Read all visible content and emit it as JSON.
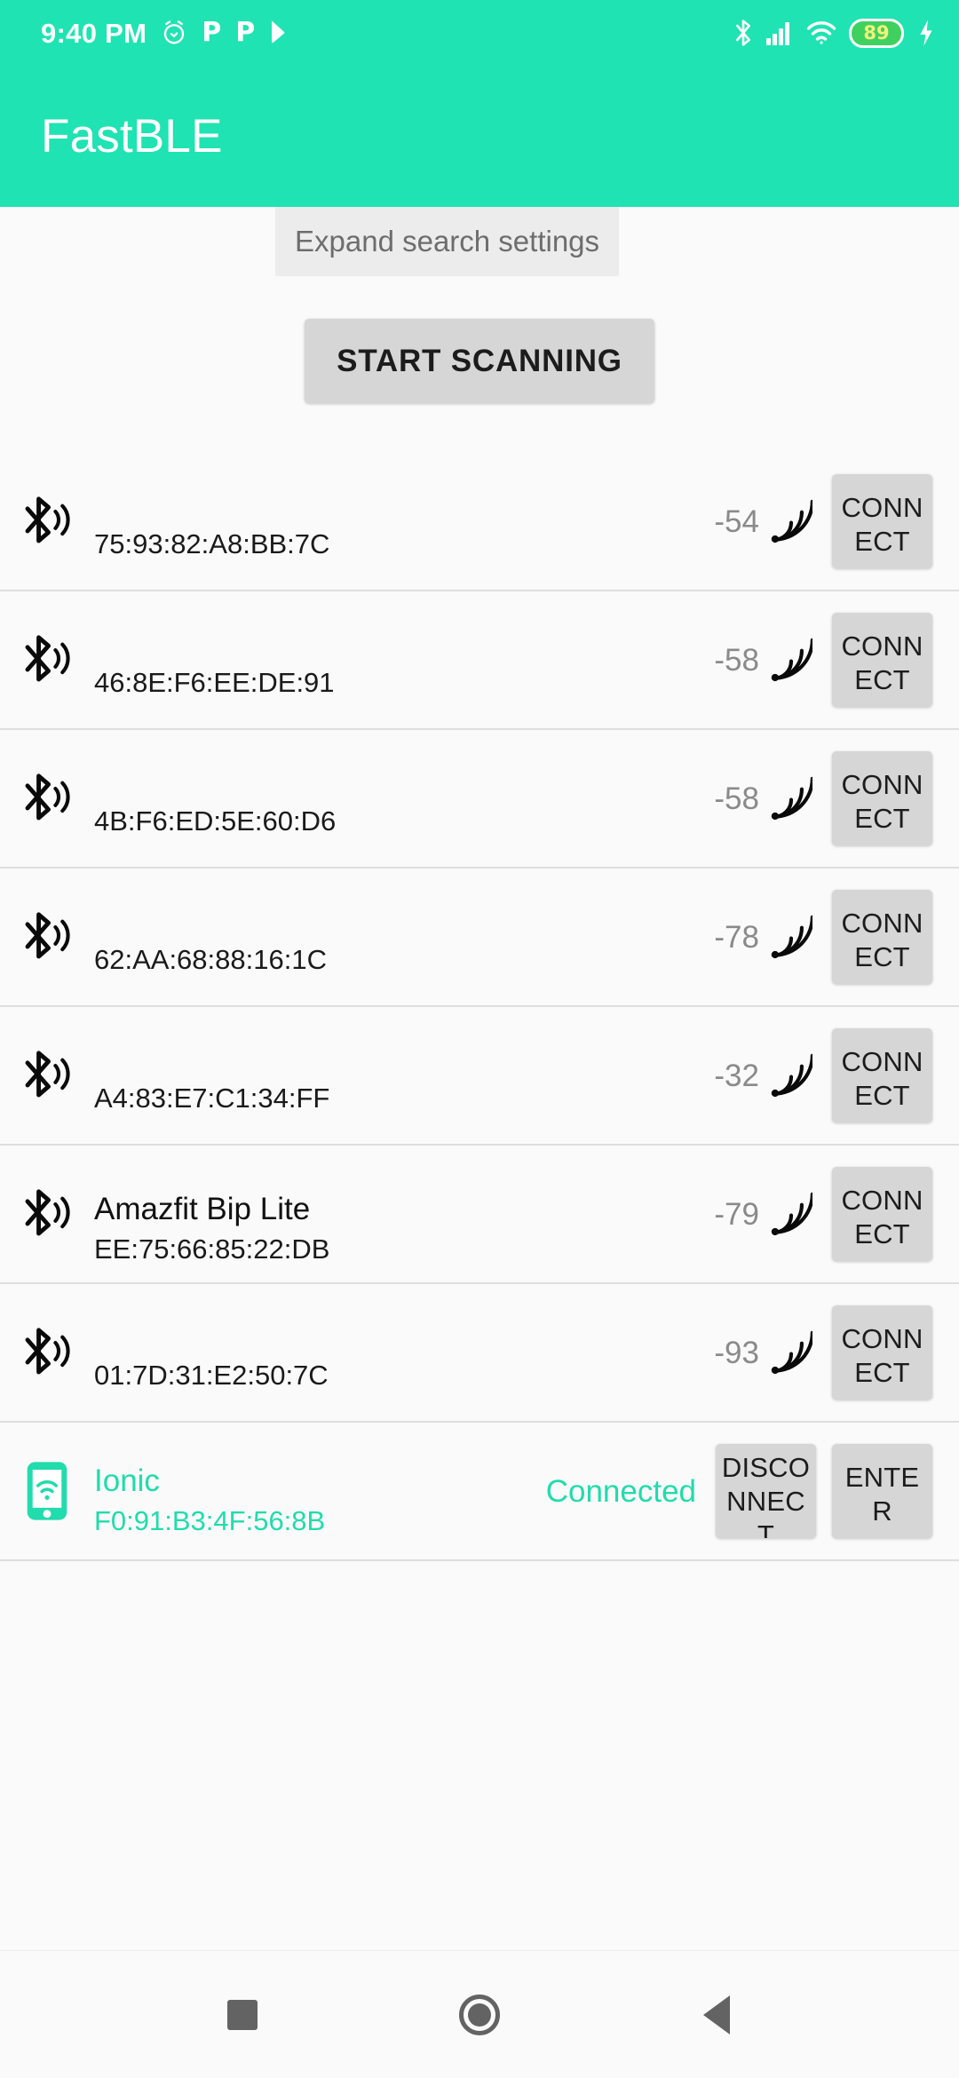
{
  "status_bar": {
    "time": "9:40 PM",
    "left_icons": [
      "alarm-clock-icon",
      "p-badge-icon",
      "p-badge-icon",
      "play-store-icon"
    ],
    "p_glyph": "P",
    "right_icons": [
      "bluetooth-icon",
      "cellular-signal-icon",
      "wifi-icon",
      "battery-icon",
      "charging-bolt-icon"
    ],
    "battery_level": "89",
    "background_color": "#1fe3b2",
    "battery_fill_color": "#3fd15f",
    "battery_text_color": "#f2f27a"
  },
  "app_bar": {
    "title": "FastBLE",
    "background_color": "#1fe3b2",
    "title_color": "#ffffff"
  },
  "toolbar": {
    "expand_label": "Expand search settings",
    "scan_label": "START SCANNING"
  },
  "accent_color": "#21dcac",
  "devices": [
    {
      "icon": "bluetooth-signal-icon",
      "name": "",
      "mac": "75:93:82:A8:BB:7C",
      "rssi": "-54",
      "status": "",
      "action_primary": "CONNECT",
      "connected": false
    },
    {
      "icon": "bluetooth-signal-icon",
      "name": "",
      "mac": "46:8E:F6:EE:DE:91",
      "rssi": "-58",
      "status": "",
      "action_primary": "CONNECT",
      "connected": false
    },
    {
      "icon": "bluetooth-signal-icon",
      "name": "",
      "mac": "4B:F6:ED:5E:60:D6",
      "rssi": "-58",
      "status": "",
      "action_primary": "CONNECT",
      "connected": false
    },
    {
      "icon": "bluetooth-signal-icon",
      "name": "",
      "mac": "62:AA:68:88:16:1C",
      "rssi": "-78",
      "status": "",
      "action_primary": "CONNECT",
      "connected": false
    },
    {
      "icon": "bluetooth-signal-icon",
      "name": "",
      "mac": "A4:83:E7:C1:34:FF",
      "rssi": "-32",
      "status": "",
      "action_primary": "CONNECT",
      "connected": false
    },
    {
      "icon": "bluetooth-signal-icon",
      "name": "Amazfit Bip Lite",
      "mac": "EE:75:66:85:22:DB",
      "rssi": "-79",
      "status": "",
      "action_primary": "CONNECT",
      "connected": false
    },
    {
      "icon": "bluetooth-signal-icon",
      "name": "",
      "mac": "01:7D:31:E2:50:7C",
      "rssi": "-93",
      "status": "",
      "action_primary": "CONNECT",
      "connected": false
    }
  ],
  "connected_device": {
    "icon": "phone-wifi-icon",
    "name": "Ionic",
    "mac": "F0:91:B3:4F:56:8B",
    "status": "Connected",
    "action_primary": "DISCONNECT",
    "action_secondary": "ENTER",
    "connected": true
  },
  "nav_bar": {
    "recents_label": "recents",
    "home_label": "home",
    "back_label": "back",
    "icon_color": "#636363"
  }
}
